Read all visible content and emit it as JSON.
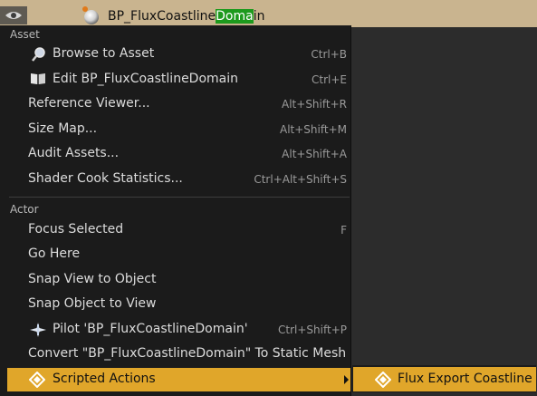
{
  "outliner": {
    "actor_name_prefix": "BP_FluxCoastline",
    "actor_name_highlight": "Doma",
    "actor_name_suffix": "in"
  },
  "menu": {
    "sections": {
      "asset": "Asset",
      "actor": "Actor"
    },
    "asset_items": [
      {
        "label": "Browse to Asset",
        "shortcut": "Ctrl+B",
        "icon": "magnifier-icon"
      },
      {
        "label": "Edit BP_FluxCoastlineDomain",
        "shortcut": "Ctrl+E",
        "icon": "book-icon"
      },
      {
        "label": "Reference Viewer...",
        "shortcut": "Alt+Shift+R"
      },
      {
        "label": "Size Map...",
        "shortcut": "Alt+Shift+M"
      },
      {
        "label": "Audit Assets...",
        "shortcut": "Alt+Shift+A"
      },
      {
        "label": "Shader Cook Statistics...",
        "shortcut": "Ctrl+Alt+Shift+S"
      }
    ],
    "actor_items": [
      {
        "label": "Focus Selected",
        "shortcut": "F"
      },
      {
        "label": "Go Here",
        "shortcut": ""
      },
      {
        "label": "Snap View to Object",
        "shortcut": ""
      },
      {
        "label": "Snap Object to View",
        "shortcut": ""
      },
      {
        "label": "Pilot 'BP_FluxCoastlineDomain'",
        "shortcut": "Ctrl+Shift+P",
        "icon": "airplane-icon"
      },
      {
        "label": "Convert \"BP_FluxCoastlineDomain\" To Static Mesh",
        "shortcut": ""
      },
      {
        "label": "Scripted Actions",
        "shortcut": "",
        "icon": "diamond-icon",
        "highlighted": true
      }
    ]
  },
  "submenu": {
    "items": [
      {
        "label": "Flux Export Coastline",
        "icon": "diamond-icon",
        "highlighted": true
      }
    ]
  },
  "colors": {
    "highlight": "#e0a62a",
    "menu_bg": "#1b1b1b",
    "search_match": "#1d9a1d"
  }
}
